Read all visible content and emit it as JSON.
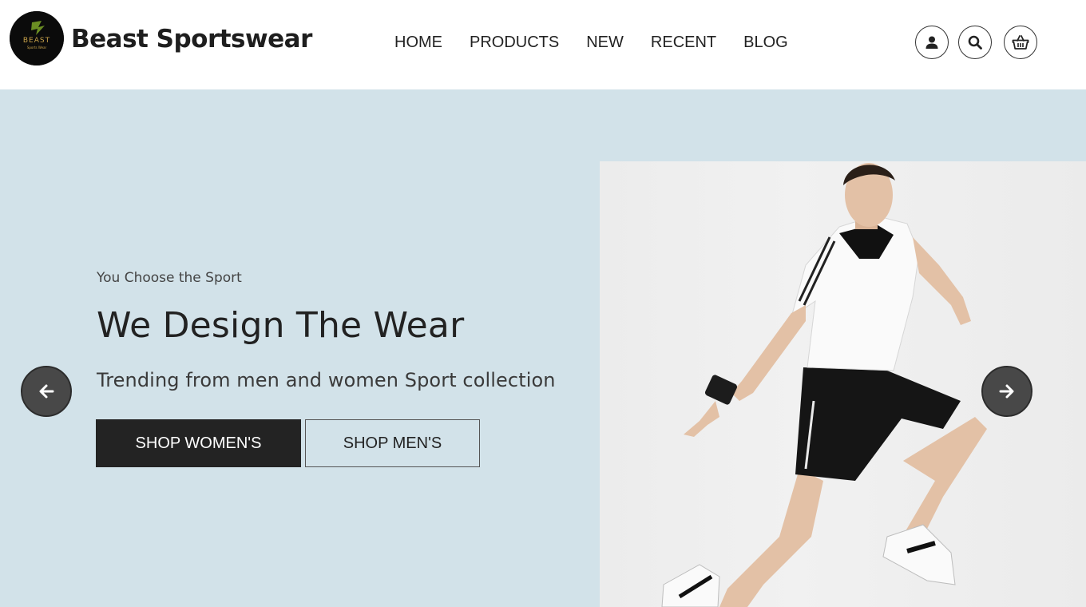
{
  "brand": {
    "name": "Beast Sportswear",
    "logo_text": "BEAST",
    "logo_subtext": "Sports Wear"
  },
  "nav": {
    "items": [
      {
        "label": "HOME"
      },
      {
        "label": "PRODUCTS"
      },
      {
        "label": "NEW"
      },
      {
        "label": "RECENT"
      },
      {
        "label": "BLOG"
      }
    ]
  },
  "header_icons": [
    "user-icon",
    "search-icon",
    "basket-icon"
  ],
  "hero": {
    "kicker": "You Choose the Sport",
    "headline": "We Design The Wear",
    "subline": "Trending from men and women Sport collection",
    "primary_button": "SHOP WOMEN'S",
    "secondary_button": "SHOP MEN'S",
    "background_color": "#d2e2e9",
    "prev_icon": "arrow-left-icon",
    "next_icon": "arrow-right-icon"
  },
  "colors": {
    "dark": "#232323",
    "hero_bg": "#d2e2e9",
    "arrow_bg": "#484848"
  }
}
